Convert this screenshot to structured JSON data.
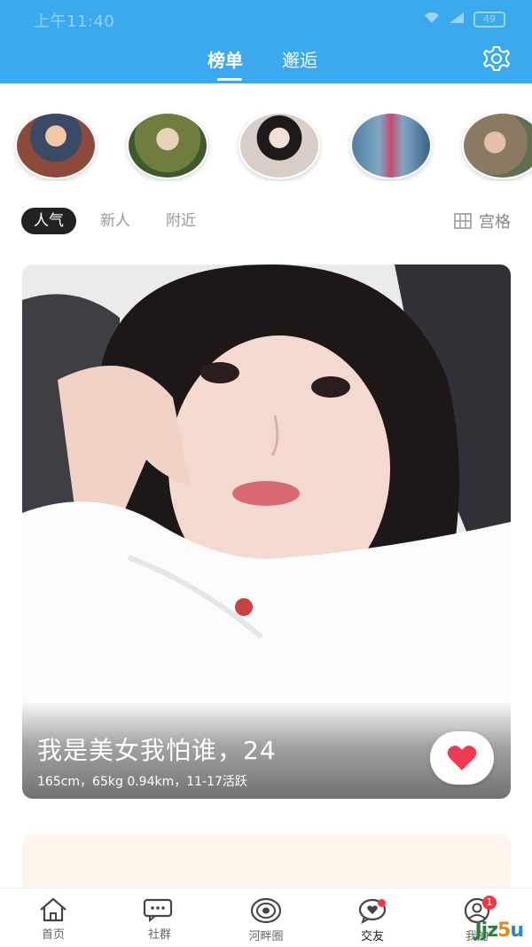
{
  "status_bar": {
    "time": "上午11:40",
    "battery": "49"
  },
  "header": {
    "tabs": [
      {
        "label": "榜单",
        "active": true
      },
      {
        "label": "邂逅",
        "active": false
      }
    ],
    "settings_icon": "gear-icon",
    "background_color": "#3aa9ee"
  },
  "avatars": [
    {
      "icon": "avatar"
    },
    {
      "icon": "avatar"
    },
    {
      "icon": "avatar"
    },
    {
      "icon": "avatar"
    },
    {
      "icon": "avatar"
    }
  ],
  "filters": [
    {
      "label": "人气",
      "active": true
    },
    {
      "label": "新人",
      "active": false
    },
    {
      "label": "附近",
      "active": false
    }
  ],
  "view_toggle": {
    "label": "宫格",
    "icon": "grid-icon"
  },
  "featured_card": {
    "name_age": "我是美女我怕谁，24",
    "meta": "165cm，65kg  0.94km，11-17活跃",
    "like_icon": "heart-icon",
    "like_color": "#ef3a4f"
  },
  "bottom_nav": [
    {
      "label": "首页",
      "icon": "home-icon"
    },
    {
      "label": "社群",
      "icon": "chat-icon"
    },
    {
      "label": "河畔圈",
      "icon": "circle-icon"
    },
    {
      "label": "交友",
      "icon": "heart-chat-icon",
      "has_dot": true
    },
    {
      "label": "我的",
      "icon": "user-icon",
      "badge": "1"
    }
  ],
  "watermark": {
    "text": "Jjz5u"
  }
}
